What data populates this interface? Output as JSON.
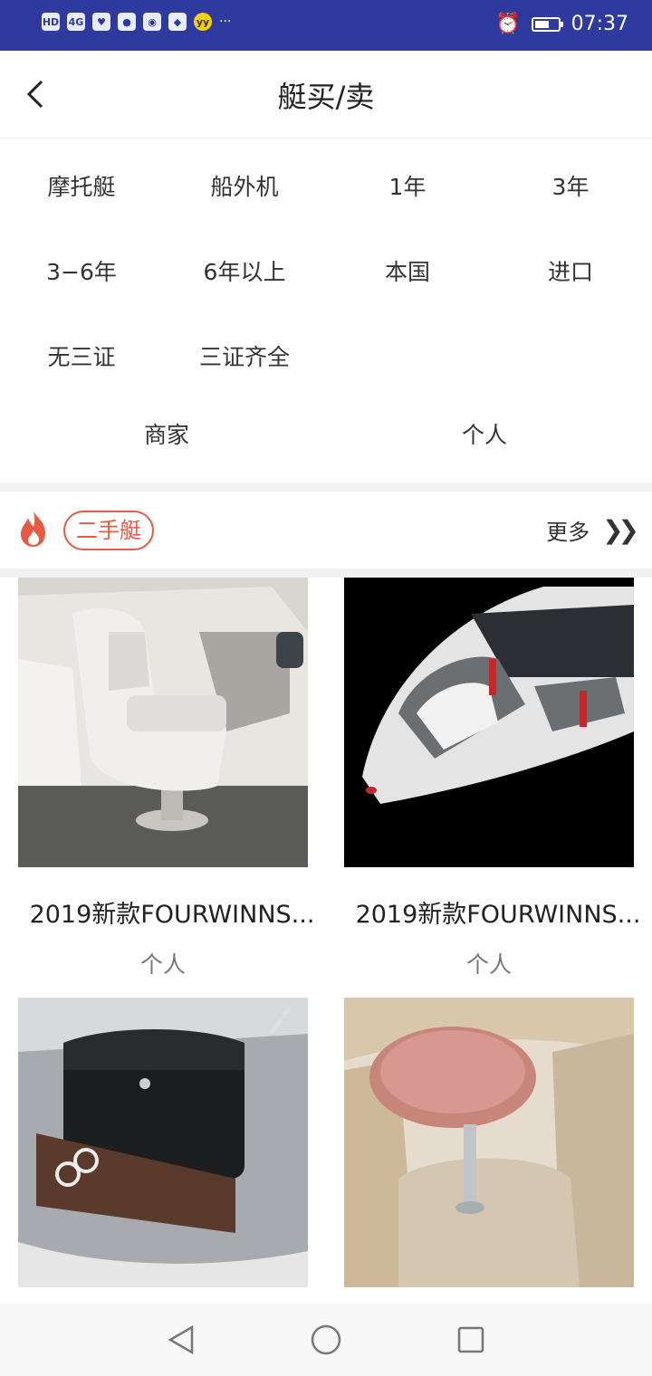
{
  "status_bar": {
    "left_icons": [
      "hd-icon",
      "4g-signal-icon",
      "heart-app-icon",
      "baidu-icon",
      "wechat-icon",
      "map-app-icon",
      "yy-icon"
    ],
    "more": "···",
    "time": "07:37",
    "battery_level": 0.55
  },
  "header": {
    "title": "艇买/卖",
    "back_icon": "chevron-left-icon"
  },
  "filters": {
    "row1": [
      "摩托艇",
      "船外机",
      "1年",
      "3年"
    ],
    "row2": [
      "3−6年",
      "6年以上",
      "本国",
      "进口"
    ],
    "row3": [
      "无三证",
      "三证齐全"
    ],
    "row4": [
      "商家",
      "个人"
    ]
  },
  "section": {
    "badge": "二手艇",
    "more": "更多",
    "fire_icon": "fire-icon",
    "more_icon": "double-chevron-right-icon"
  },
  "listings": [
    {
      "title": "2019新款FOURWINNS...",
      "seller": "个人"
    },
    {
      "title": "2019新款FOURWINNS...",
      "seller": "个人"
    },
    {
      "title": "",
      "seller": ""
    },
    {
      "title": "",
      "seller": ""
    }
  ],
  "colors": {
    "status_bar": "#2f3a9e",
    "accent": "#e85a44"
  }
}
